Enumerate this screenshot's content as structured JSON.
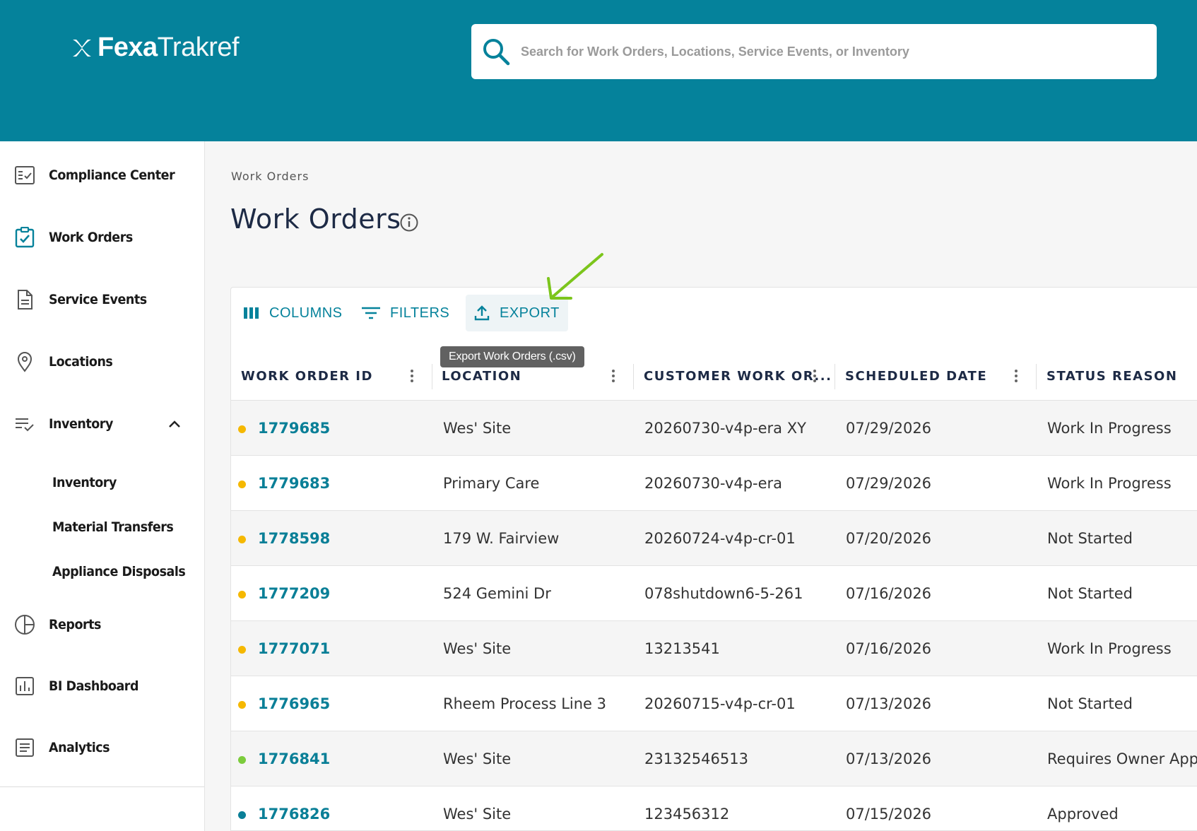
{
  "header": {
    "logo_bold": "Fexa",
    "logo_light": "Trakref",
    "search_placeholder": "Search for Work Orders, Locations, Service Events, or Inventory"
  },
  "sidebar": {
    "items": [
      {
        "label": "Compliance Center",
        "icon": "checklist-icon"
      },
      {
        "label": "Work Orders",
        "icon": "clipboard-check-icon"
      },
      {
        "label": "Service Events",
        "icon": "document-icon"
      },
      {
        "label": "Locations",
        "icon": "location-pin-icon"
      },
      {
        "label": "Inventory",
        "icon": "list-check-icon"
      },
      {
        "label": "Reports",
        "icon": "pie-chart-icon"
      },
      {
        "label": "BI Dashboard",
        "icon": "bar-chart-icon"
      },
      {
        "label": "Analytics",
        "icon": "text-document-icon"
      }
    ],
    "inventory_sub": [
      "Inventory",
      "Material Transfers",
      "Appliance Disposals"
    ]
  },
  "breadcrumb": "Work Orders",
  "page_title": "Work Orders",
  "toolbar": {
    "columns_label": "COLUMNS",
    "filters_label": "FILTERS",
    "export_label": "EXPORT",
    "export_tooltip": "Export Work Orders (.csv)"
  },
  "table": {
    "headers": [
      "WORK ORDER ID",
      "LOCATION",
      "CUSTOMER WORK OR...",
      "SCHEDULED DATE",
      "STATUS REASON"
    ],
    "rows": [
      {
        "id": "1779685",
        "location": "Wes' Site",
        "customer_wo": "20260730-v4p-era XY",
        "scheduled": "07/29/2026",
        "status": "Work In Progress",
        "dot": "#f5b800"
      },
      {
        "id": "1779683",
        "location": "Primary Care",
        "customer_wo": "20260730-v4p-era",
        "scheduled": "07/29/2026",
        "status": "Work In Progress",
        "dot": "#f5b800"
      },
      {
        "id": "1778598",
        "location": "179 W. Fairview",
        "customer_wo": "20260724-v4p-cr-01",
        "scheduled": "07/20/2026",
        "status": "Not Started",
        "dot": "#f5b800"
      },
      {
        "id": "1777209",
        "location": "524 Gemini Dr",
        "customer_wo": "078shutdown6-5-261",
        "scheduled": "07/16/2026",
        "status": "Not Started",
        "dot": "#f5b800"
      },
      {
        "id": "1777071",
        "location": "Wes' Site",
        "customer_wo": "13213541",
        "scheduled": "07/16/2026",
        "status": "Work In Progress",
        "dot": "#f5b800"
      },
      {
        "id": "1776965",
        "location": "Rheem Process Line 3",
        "customer_wo": "20260715-v4p-cr-01",
        "scheduled": "07/13/2026",
        "status": "Not Started",
        "dot": "#f5b800"
      },
      {
        "id": "1776841",
        "location": "Wes' Site",
        "customer_wo": "23132546513",
        "scheduled": "07/13/2026",
        "status": "Requires Owner Appr",
        "dot": "#7ccc3c"
      },
      {
        "id": "1776826",
        "location": "Wes' Site",
        "customer_wo": "123456312",
        "scheduled": "07/15/2026",
        "status": "Approved",
        "dot": "#0a7f97"
      }
    ]
  },
  "colors": {
    "header_bg": "#05829b",
    "link": "#0a7f97",
    "annotation_arrow": "#7cc51c"
  }
}
